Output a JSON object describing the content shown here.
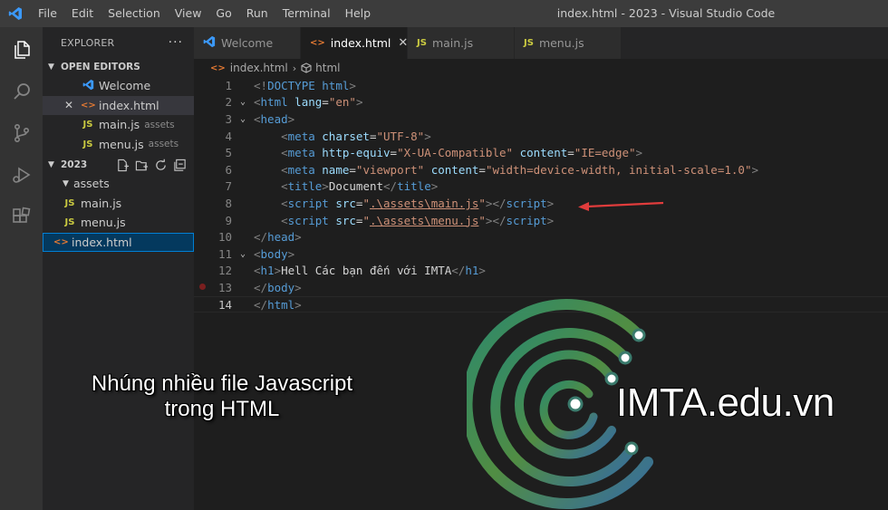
{
  "window": {
    "title": "index.html - 2023 - Visual Studio Code",
    "menu": [
      "File",
      "Edit",
      "Selection",
      "View",
      "Go",
      "Run",
      "Terminal",
      "Help"
    ]
  },
  "activity_bar": [
    "files-icon",
    "search-icon",
    "source-control-icon",
    "run-debug-icon",
    "extensions-icon"
  ],
  "sidebar": {
    "title": "EXPLORER",
    "more": "···",
    "open_editors": {
      "label": "OPEN EDITORS",
      "items": [
        {
          "icon": "vscode-icon",
          "name": "Welcome",
          "dir": ""
        },
        {
          "icon": "html-icon",
          "name": "index.html",
          "dir": ""
        },
        {
          "icon": "js-icon",
          "name": "main.js",
          "dir": "assets"
        },
        {
          "icon": "js-icon",
          "name": "menu.js",
          "dir": "assets"
        }
      ]
    },
    "workspace": {
      "label": "2023",
      "folder": "assets",
      "files": [
        "main.js",
        "menu.js"
      ],
      "root_file": "index.html"
    },
    "js_badge": "JS",
    "html_badge": "<>"
  },
  "tabs": [
    {
      "label": "Welcome",
      "active": false
    },
    {
      "label": "index.html",
      "active": true,
      "close": "✕"
    },
    {
      "label": "main.js",
      "active": false
    },
    {
      "label": "menu.js",
      "active": false
    }
  ],
  "breadcrumb": {
    "file": "index.html",
    "symbol": "html"
  },
  "code": {
    "line_numbers": [
      "1",
      "2",
      "3",
      "4",
      "5",
      "6",
      "7",
      "8",
      "9",
      "10",
      "11",
      "12",
      "13",
      "14"
    ],
    "doctype": "<!DOCTYPE html>",
    "doctype_kw": "html",
    "html_lang": "en",
    "charset": "UTF-8",
    "http_equiv": "X-UA-Compatible",
    "content_ie": "IE=edge",
    "viewport": "viewport",
    "viewport_content": "width=device-width, initial-scale=1.0",
    "title": "Document",
    "script1": ".\\assets\\main.js",
    "script2": ".\\assets\\menu.js",
    "h1_text": "Hell Các bạn đến với IMTA"
  },
  "overlay": {
    "caption_line1": "Nhúng nhiều file Javascript",
    "caption_line2": "trong HTML",
    "brand": "IMTA.edu.vn"
  },
  "colors": {
    "arrow": "#e03c3c",
    "accent": "#007acc"
  }
}
